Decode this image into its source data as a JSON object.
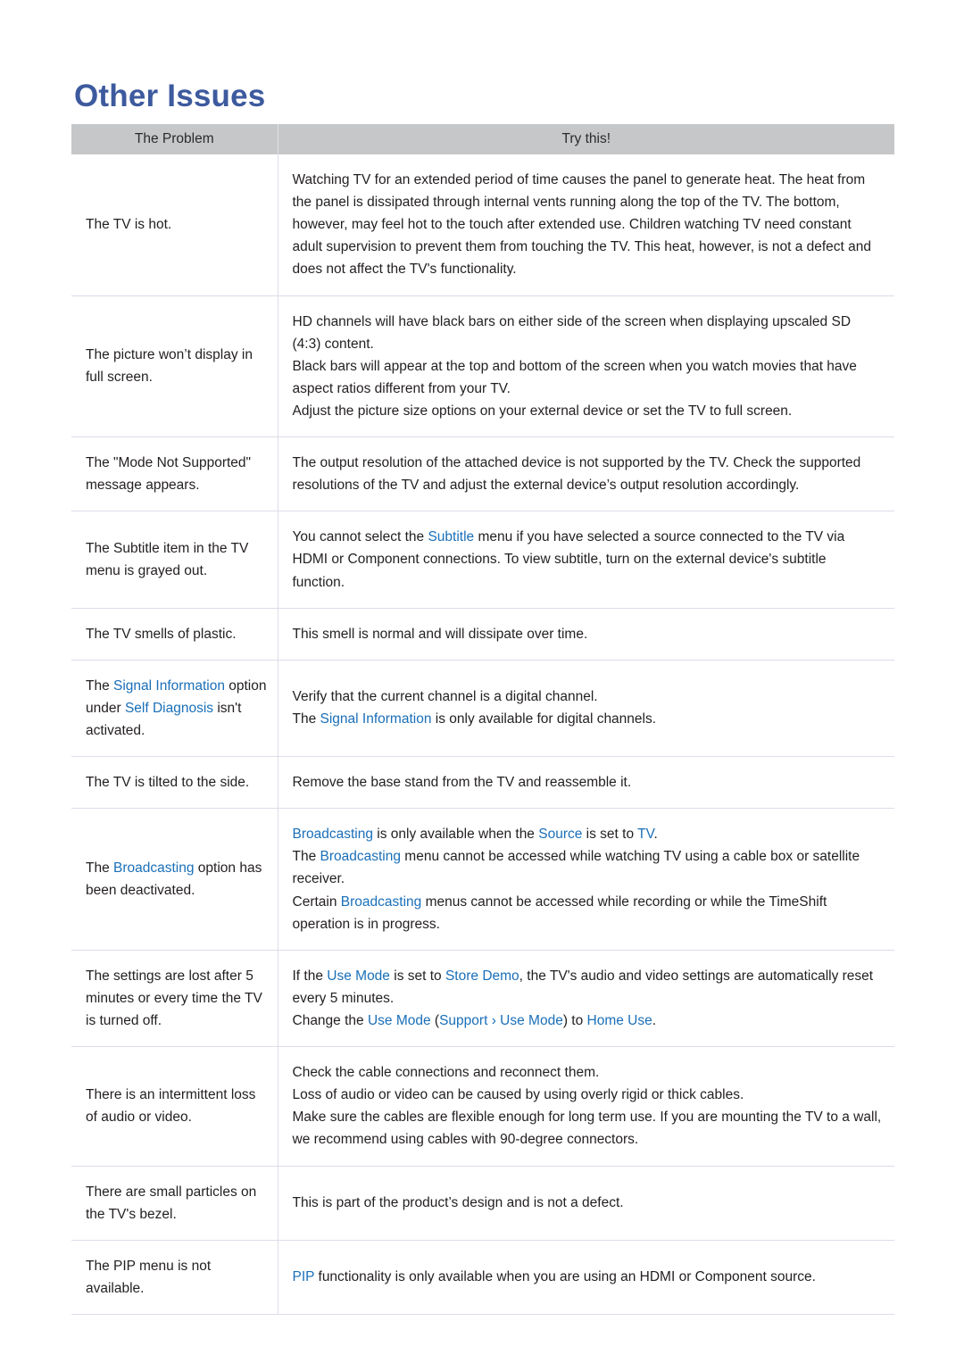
{
  "page": {
    "title": "Other Issues",
    "title_color": "#3d5a9e",
    "highlight_color": "#1a6fb8",
    "header_bg": "#c6c7c9"
  },
  "table": {
    "headers": {
      "problem": "The Problem",
      "fix": "Try this!"
    },
    "rows": [
      {
        "problem": [
          {
            "parts": [
              {
                "t": "The TV is hot."
              }
            ]
          }
        ],
        "fix": [
          {
            "parts": [
              {
                "t": "Watching TV for an extended period of time causes the panel to generate heat. The heat from the panel is dissipated through internal vents running along the top of the TV. The bottom, however, may feel hot to the touch after extended use. Children watching TV need constant adult supervision to prevent them from touching the TV. This heat, however, is not a defect and does not affect the TV's functionality."
              }
            ]
          }
        ]
      },
      {
        "problem": [
          {
            "parts": [
              {
                "t": "The picture won’t display in full screen."
              }
            ]
          }
        ],
        "fix": [
          {
            "parts": [
              {
                "t": "HD channels will have black bars on either side of the screen when displaying upscaled SD (4:3) content."
              }
            ]
          },
          {
            "parts": [
              {
                "t": "Black bars will appear at the top and bottom of the screen when you watch movies that have aspect ratios different from your TV."
              }
            ]
          },
          {
            "parts": [
              {
                "t": "Adjust the picture size options on your external device or set the TV to full screen."
              }
            ]
          }
        ]
      },
      {
        "problem": [
          {
            "parts": [
              {
                "t": "The \"Mode Not Supported\" message appears."
              }
            ]
          }
        ],
        "fix": [
          {
            "parts": [
              {
                "t": "The output resolution of the attached device is not supported by the TV. Check the supported resolutions of the TV and adjust the external device’s output resolution accordingly."
              }
            ]
          }
        ]
      },
      {
        "problem": [
          {
            "parts": [
              {
                "t": "The Subtitle item in the TV menu is grayed out."
              }
            ]
          }
        ],
        "fix": [
          {
            "parts": [
              {
                "t": "You cannot select the "
              },
              {
                "t": "Subtitle",
                "hl": true
              },
              {
                "t": " menu if you have selected a source connected to the TV via HDMI or Component connections. To view subtitle, turn on the external device's subtitle function."
              }
            ]
          }
        ]
      },
      {
        "problem": [
          {
            "parts": [
              {
                "t": "The TV smells of plastic."
              }
            ]
          }
        ],
        "fix": [
          {
            "parts": [
              {
                "t": "This smell is normal and will dissipate over time."
              }
            ]
          }
        ]
      },
      {
        "problem": [
          {
            "parts": [
              {
                "t": "The "
              },
              {
                "t": "Signal Information",
                "hl": true
              },
              {
                "t": " option under "
              },
              {
                "t": "Self Diagnosis",
                "hl": true
              },
              {
                "t": " isn't activated."
              }
            ]
          }
        ],
        "fix": [
          {
            "parts": [
              {
                "t": "Verify that the current channel is a digital channel."
              }
            ]
          },
          {
            "parts": [
              {
                "t": "The "
              },
              {
                "t": "Signal Information",
                "hl": true
              },
              {
                "t": " is only available for digital channels."
              }
            ]
          }
        ]
      },
      {
        "problem": [
          {
            "parts": [
              {
                "t": "The TV is tilted to the side."
              }
            ]
          }
        ],
        "fix": [
          {
            "parts": [
              {
                "t": "Remove the base stand from the TV and reassemble it."
              }
            ]
          }
        ]
      },
      {
        "problem": [
          {
            "parts": [
              {
                "t": "The "
              },
              {
                "t": "Broadcasting",
                "hl": true
              },
              {
                "t": " option has been deactivated."
              }
            ]
          }
        ],
        "fix": [
          {
            "parts": [
              {
                "t": "Broadcasting",
                "hl": true
              },
              {
                "t": " is only available when the "
              },
              {
                "t": "Source",
                "hl": true
              },
              {
                "t": " is set to "
              },
              {
                "t": "TV",
                "hl": true
              },
              {
                "t": "."
              }
            ]
          },
          {
            "parts": [
              {
                "t": "The "
              },
              {
                "t": "Broadcasting",
                "hl": true
              },
              {
                "t": " menu cannot be accessed while watching TV using a cable box or satellite receiver."
              }
            ]
          },
          {
            "parts": [
              {
                "t": "Certain "
              },
              {
                "t": "Broadcasting",
                "hl": true
              },
              {
                "t": " menus cannot be accessed while recording or while the TimeShift operation is in progress."
              }
            ]
          }
        ]
      },
      {
        "problem": [
          {
            "parts": [
              {
                "t": "The settings are lost after 5 minutes or every time the TV is turned off."
              }
            ]
          }
        ],
        "fix": [
          {
            "parts": [
              {
                "t": "If the "
              },
              {
                "t": "Use Mode",
                "hl": true
              },
              {
                "t": " is set to "
              },
              {
                "t": "Store Demo",
                "hl": true
              },
              {
                "t": ", the TV's audio and video settings are automatically reset every 5 minutes."
              }
            ]
          },
          {
            "parts": [
              {
                "t": "Change the "
              },
              {
                "t": "Use Mode",
                "hl": true
              },
              {
                "t": " ("
              },
              {
                "t": "Support",
                "hl": true
              },
              {
                "t": " › ",
                "hl": true
              },
              {
                "t": "Use Mode",
                "hl": true
              },
              {
                "t": ") to "
              },
              {
                "t": "Home Use",
                "hl": true
              },
              {
                "t": "."
              }
            ]
          }
        ]
      },
      {
        "problem": [
          {
            "parts": [
              {
                "t": "There is an intermittent loss of audio or video."
              }
            ]
          }
        ],
        "fix": [
          {
            "parts": [
              {
                "t": "Check the cable connections and reconnect them."
              }
            ]
          },
          {
            "parts": [
              {
                "t": "Loss of audio or video can be caused by using overly rigid or thick cables."
              }
            ]
          },
          {
            "parts": [
              {
                "t": "Make sure the cables are flexible enough for long term use. If you are mounting the TV to a wall, we recommend using cables with 90-degree connectors."
              }
            ]
          }
        ]
      },
      {
        "problem": [
          {
            "parts": [
              {
                "t": "There are small particles on the TV's bezel."
              }
            ]
          }
        ],
        "fix": [
          {
            "parts": [
              {
                "t": "This is part of the product’s design and is not a defect."
              }
            ]
          }
        ]
      },
      {
        "problem": [
          {
            "parts": [
              {
                "t": "The PIP menu is not available."
              }
            ]
          }
        ],
        "fix": [
          {
            "parts": [
              {
                "t": "PIP",
                "hl": true
              },
              {
                "t": " functionality is only available when you are using an HDMI or Component source."
              }
            ]
          }
        ]
      }
    ]
  }
}
